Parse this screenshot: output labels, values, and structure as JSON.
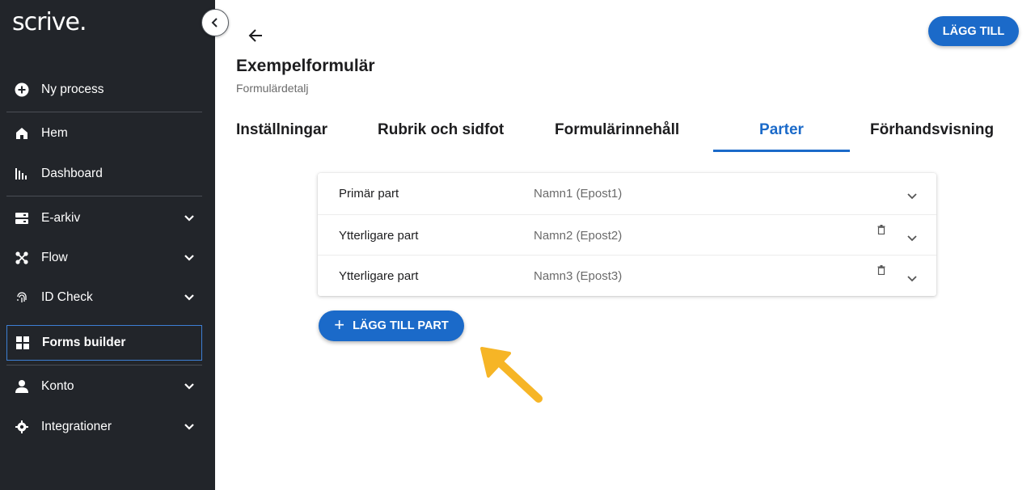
{
  "brand": {
    "logo_text": "scrive."
  },
  "sidebar": {
    "items": [
      {
        "label": "Ny process",
        "icon": "add-circle-icon",
        "has_chevron": false
      },
      {
        "label": "Hem",
        "icon": "home-icon",
        "has_chevron": false
      },
      {
        "label": "Dashboard",
        "icon": "bar-chart-icon",
        "has_chevron": false
      },
      {
        "label": "E-arkiv",
        "icon": "archive-icon",
        "has_chevron": true
      },
      {
        "label": "Flow",
        "icon": "flow-icon",
        "has_chevron": true
      },
      {
        "label": "ID Check",
        "icon": "fingerprint-icon",
        "has_chevron": true
      },
      {
        "label": "Forms builder",
        "icon": "grid-icon",
        "has_chevron": false,
        "active": true
      },
      {
        "label": "Konto",
        "icon": "person-icon",
        "has_chevron": true
      },
      {
        "label": "Integrationer",
        "icon": "gear-icon",
        "has_chevron": true
      }
    ]
  },
  "header": {
    "title": "Exempelformulär",
    "subtitle": "Formulärdetalj",
    "add_button_label": "LÄGG TILL"
  },
  "tabs": [
    {
      "label": "Inställningar",
      "active": false
    },
    {
      "label": "Rubrik och sidfot",
      "active": false
    },
    {
      "label": "Formulärinnehåll",
      "active": false
    },
    {
      "label": "Parter",
      "active": true
    },
    {
      "label": "Förhandsvisning",
      "active": false
    }
  ],
  "parties": [
    {
      "role": "Primär part",
      "person": "Namn1 (Epost1)",
      "deletable": false
    },
    {
      "role": "Ytterligare part",
      "person": "Namn2 (Epost2)",
      "deletable": true
    },
    {
      "role": "Ytterligare part",
      "person": "Namn3 (Epost3)",
      "deletable": true
    }
  ],
  "add_party_button": {
    "icon": "+",
    "label": "LÄGG TILL PART"
  },
  "colors": {
    "accent": "#1b6ac9",
    "sidebar_bg": "#22252a",
    "pointer": "#f6b526"
  }
}
